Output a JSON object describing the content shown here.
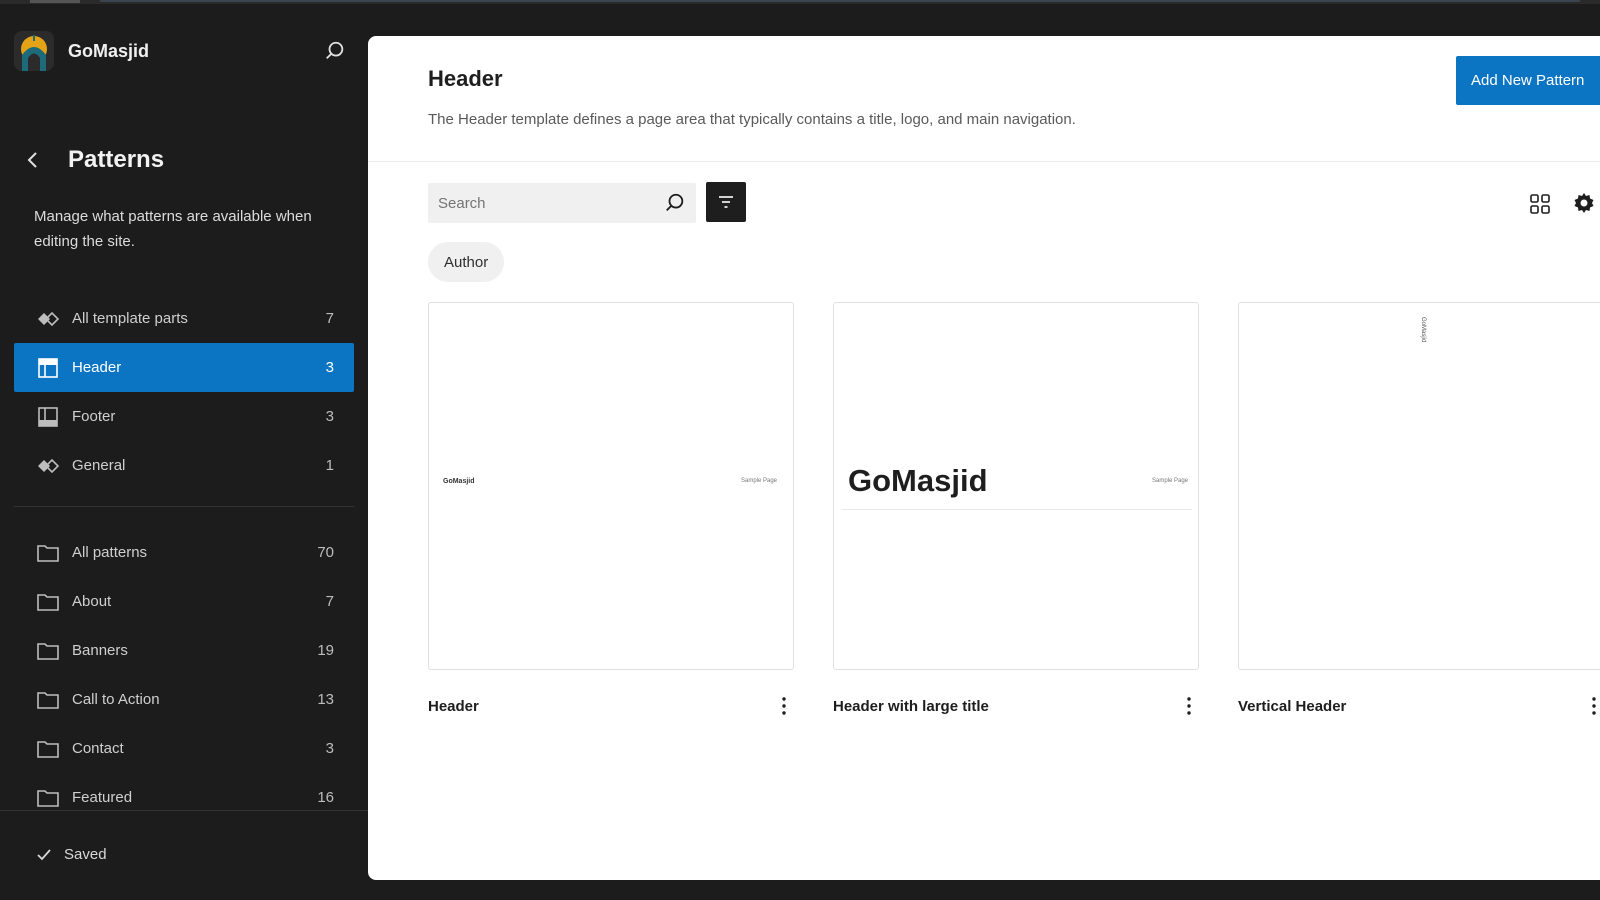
{
  "site": {
    "name": "GoMasjid"
  },
  "sidebar": {
    "title": "Patterns",
    "description": "Manage what patterns are available when editing the site.",
    "template_parts": [
      {
        "label": "All template parts",
        "count": "7",
        "icon": "diamond-icon"
      },
      {
        "label": "Header",
        "count": "3",
        "icon": "header-layout-icon",
        "active": true
      },
      {
        "label": "Footer",
        "count": "3",
        "icon": "footer-layout-icon"
      },
      {
        "label": "General",
        "count": "1",
        "icon": "diamond-icon"
      }
    ],
    "categories": [
      {
        "label": "All patterns",
        "count": "70",
        "icon": "folder-icon"
      },
      {
        "label": "About",
        "count": "7",
        "icon": "folder-icon"
      },
      {
        "label": "Banners",
        "count": "19",
        "icon": "folder-icon"
      },
      {
        "label": "Call to Action",
        "count": "13",
        "icon": "folder-icon"
      },
      {
        "label": "Contact",
        "count": "3",
        "icon": "folder-icon"
      },
      {
        "label": "Featured",
        "count": "16",
        "icon": "folder-icon"
      }
    ],
    "status": "Saved"
  },
  "main": {
    "title": "Header",
    "description": "The Header template defines a page area that typically contains a title, logo, and main navigation.",
    "add_button": "Add New Pattern",
    "search_placeholder": "Search",
    "filter_chip": "Author",
    "patterns": [
      {
        "title": "Header",
        "preview_site": "GoMasjid",
        "preview_link": "Sample Page"
      },
      {
        "title": "Header with large title",
        "preview_site": "GoMasjid",
        "preview_link": "Sample Page"
      },
      {
        "title": "Vertical Header",
        "preview_site": "GoMasjid"
      }
    ]
  },
  "colors": {
    "accent": "#0b74c3",
    "sidebar_bg": "#1c1c1c",
    "panel_bg": "#ffffff"
  }
}
